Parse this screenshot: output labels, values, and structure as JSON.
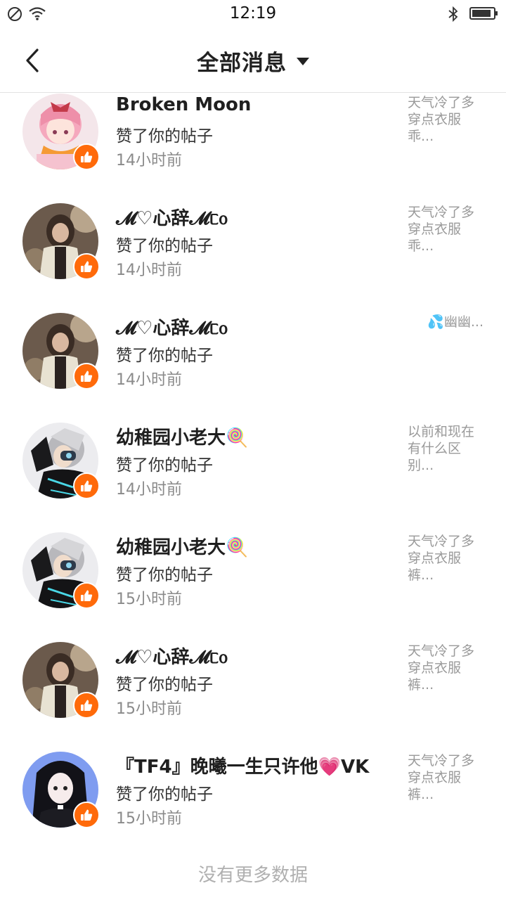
{
  "status_bar": {
    "time": "12:19"
  },
  "nav": {
    "title": "全部消息"
  },
  "items": [
    {
      "name": "Broken Moon",
      "action": "赞了你的帖子",
      "time": "14小时前",
      "preview": "天气冷了多穿点衣服乖...",
      "avatar": "pink-anime-girl"
    },
    {
      "name": "𝓜♡心辞𝓜ᥴ᧐",
      "action": "赞了你的帖子",
      "time": "14小时前",
      "preview": "天气冷了多穿点衣服乖...",
      "avatar": "girl-photo"
    },
    {
      "name": "𝓜♡心辞𝓜ᥴ᧐",
      "action": "赞了你的帖子",
      "time": "14小时前",
      "preview": "💦幽幽...",
      "avatar": "girl-photo"
    },
    {
      "name": "幼稚园小老大🍭",
      "action": "赞了你的帖子",
      "time": "14小时前",
      "preview": "以前和现在有什么区别...",
      "avatar": "cyber-boy"
    },
    {
      "name": "幼稚园小老大🍭",
      "action": "赞了你的帖子",
      "time": "15小时前",
      "preview": "天气冷了多穿点衣服裤...",
      "avatar": "cyber-boy"
    },
    {
      "name": "𝓜♡心辞𝓜ᥴ᧐",
      "action": "赞了你的帖子",
      "time": "15小时前",
      "preview": "天气冷了多穿点衣服裤...",
      "avatar": "girl-photo"
    },
    {
      "name": "『TF4』晚曦一生只许他💗VK",
      "action": "赞了你的帖子",
      "time": "15小时前",
      "preview": "天气冷了多穿点衣服裤...",
      "avatar": "dark-anime-girl"
    }
  ],
  "footer": {
    "text": "没有更多数据"
  },
  "colors": {
    "accent": "#ff6a0a",
    "muted": "#9a9a9a"
  }
}
